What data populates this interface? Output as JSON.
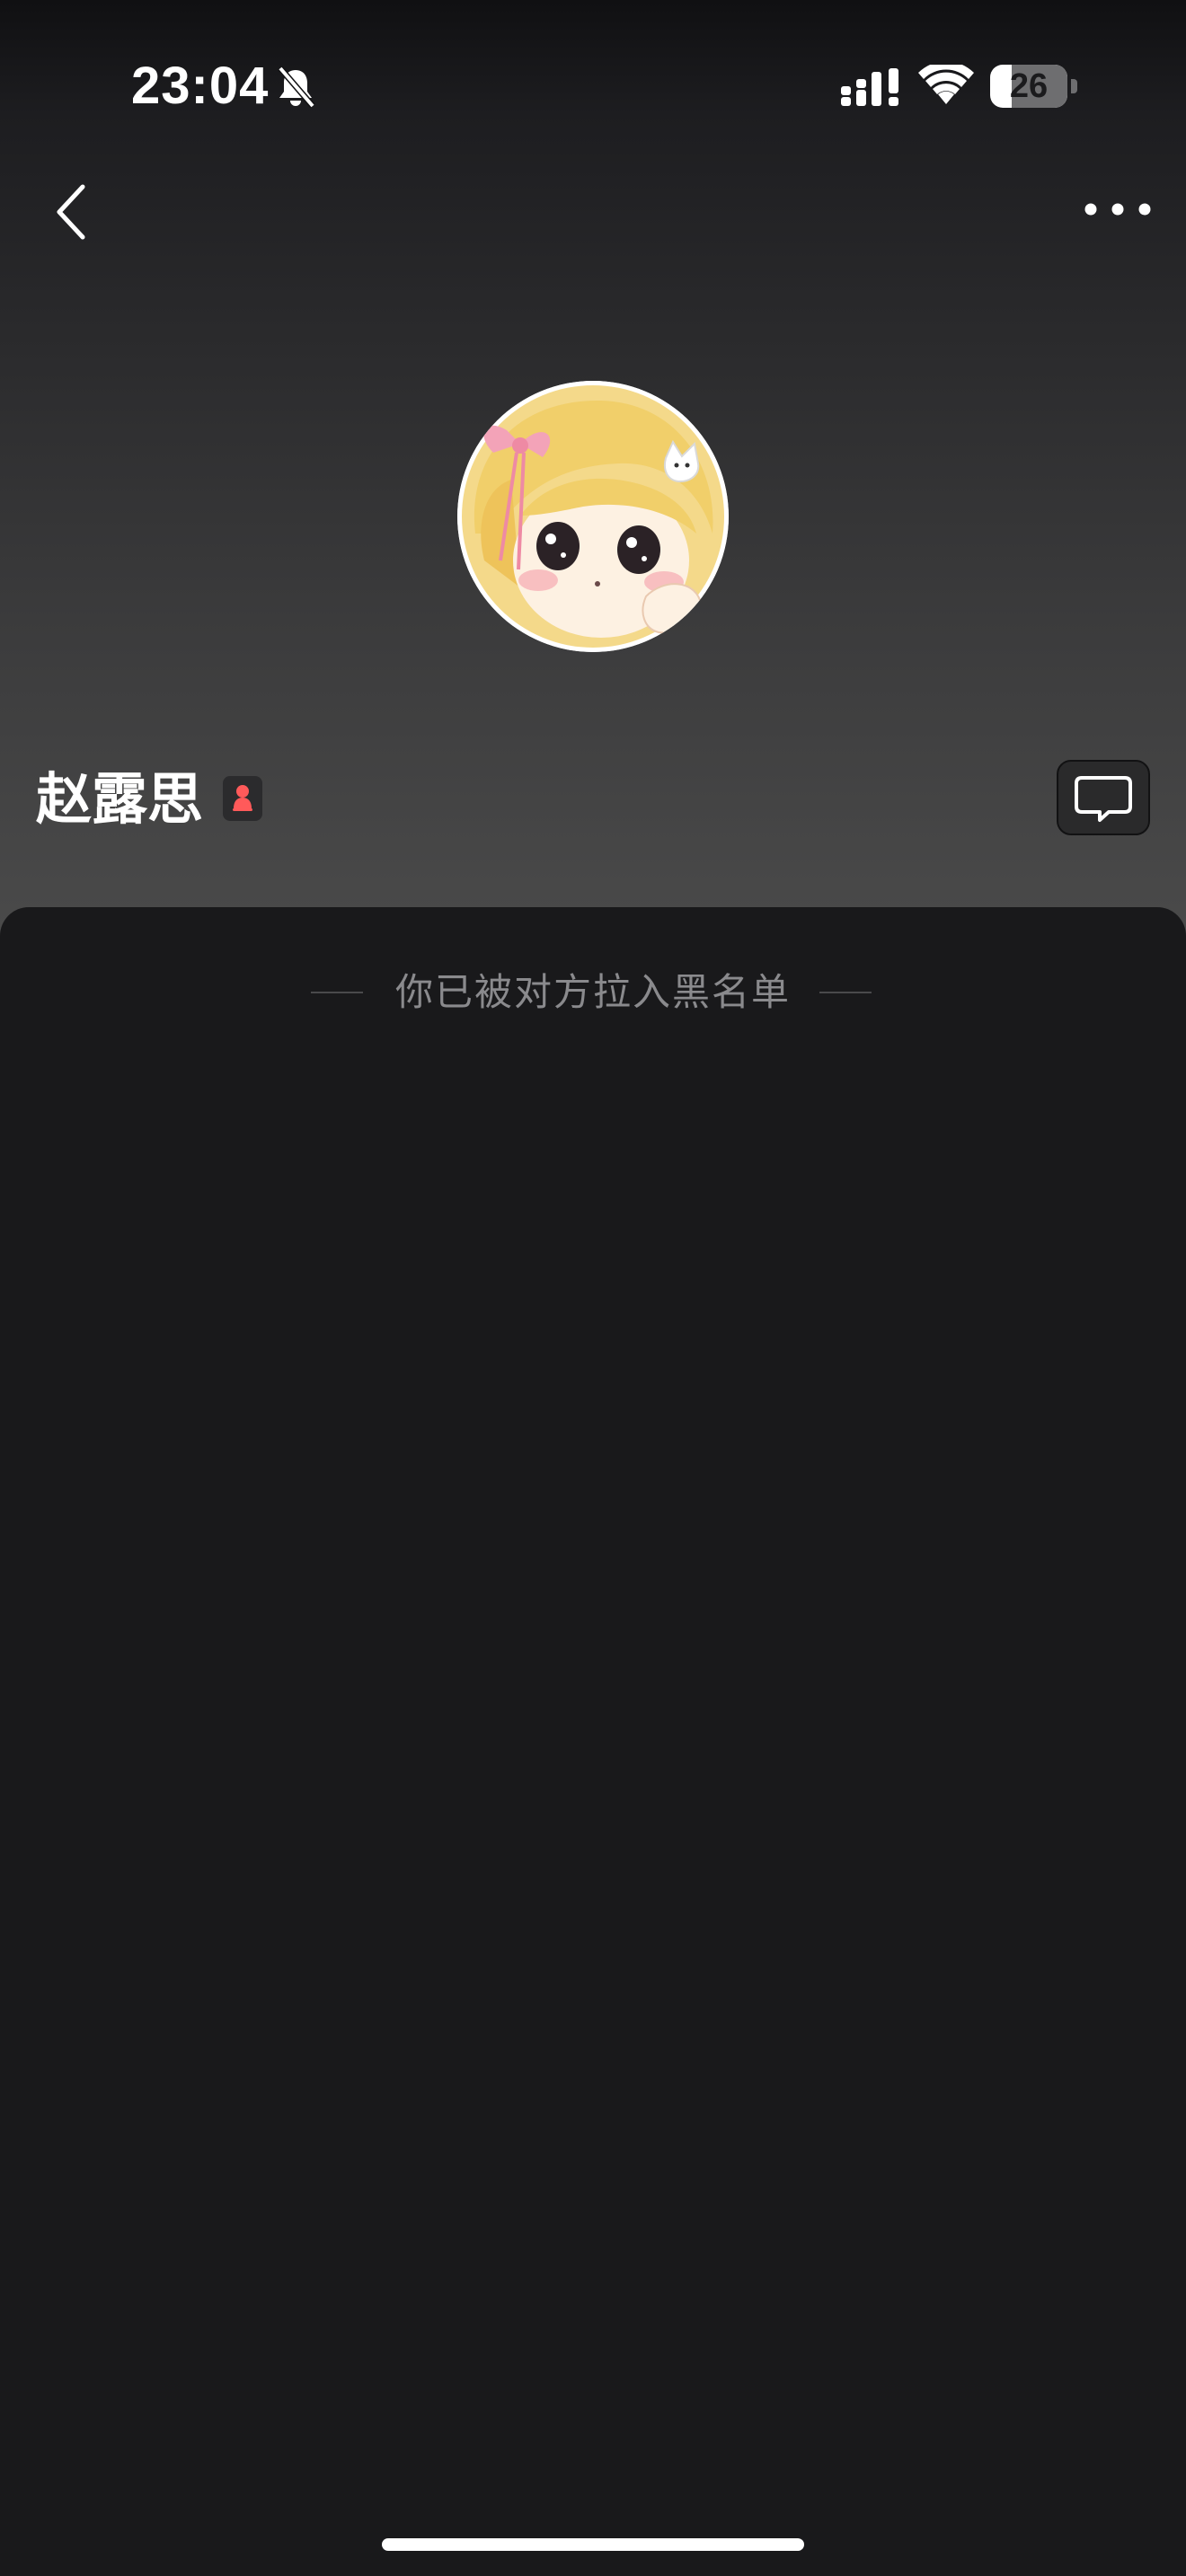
{
  "status_bar": {
    "time": "23:04",
    "battery_level": "26",
    "icons": [
      "bell-muted-icon",
      "signal-icon",
      "wifi-icon",
      "battery-icon"
    ]
  },
  "nav": {
    "back_icon": "chevron-left-icon",
    "more_icon": "ellipsis-icon"
  },
  "profile": {
    "name": "赵露思",
    "gender_icon": "female-icon",
    "gender_color": "#ff5a5a",
    "message_icon": "speech-bubble-icon"
  },
  "content": {
    "blocked_message": "你已被对方拉入黑名单"
  },
  "colors": {
    "background": "#19191b",
    "header_gradient_top": "#101012",
    "header_gradient_bottom": "#4b4b4b",
    "muted_text": "#8a8a8d"
  }
}
